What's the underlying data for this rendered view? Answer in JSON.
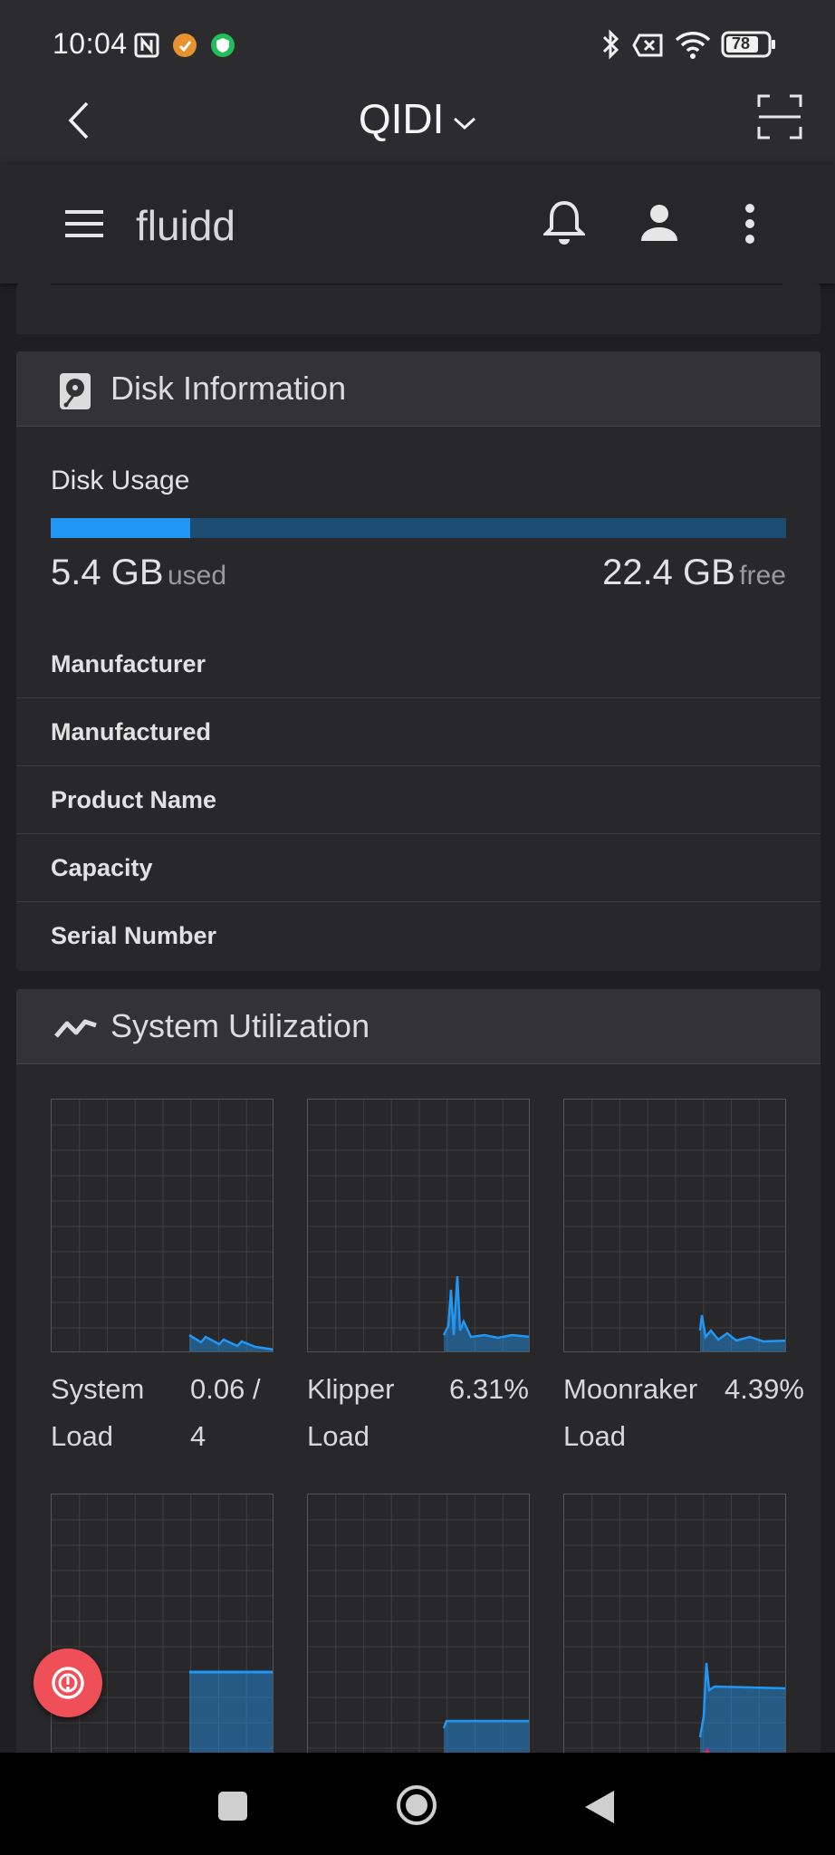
{
  "status_bar": {
    "time": "10:04",
    "battery": "78"
  },
  "browser": {
    "title": "QIDI"
  },
  "app_bar": {
    "logo": "fluidd"
  },
  "disk_card": {
    "title": "Disk Information",
    "usage_label": "Disk Usage",
    "usage_fraction": 0.19,
    "used_value": "5.4 GB",
    "used_suffix": "used",
    "free_value": "22.4 GB",
    "free_suffix": "free",
    "properties": [
      "Manufacturer",
      "Manufactured",
      "Product Name",
      "Capacity",
      "Serial Number"
    ]
  },
  "utilization_card": {
    "title": "System Utilization",
    "charts": [
      {
        "label_line1": "System",
        "label_line2": "Load",
        "value_line1": "0.06 /",
        "value_line2": "4"
      },
      {
        "label_line1": "Klipper",
        "label_line2": "Load",
        "value_line1": "6.31%",
        "value_line2": ""
      },
      {
        "label_line1": "Moonraker",
        "label_line2": "Load",
        "value_line1": "4.39%",
        "value_line2": ""
      }
    ]
  },
  "colors": {
    "accent": "#2196f3",
    "fab": "#ef4f56",
    "series_secondary": "#e91e63"
  }
}
